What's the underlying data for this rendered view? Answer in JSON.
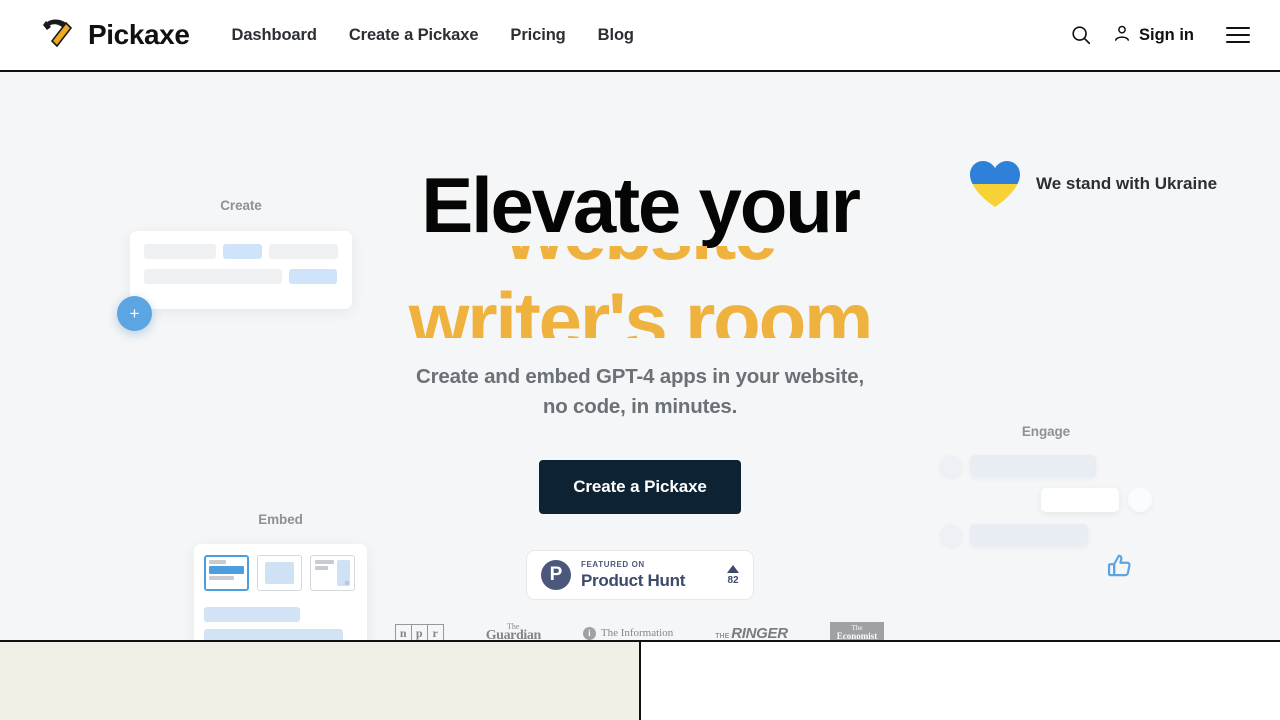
{
  "header": {
    "brand": "Pickaxe",
    "logo_icon": "pickaxe-hammer-icon",
    "nav": [
      {
        "label": "Dashboard"
      },
      {
        "label": "Create a Pickaxe"
      },
      {
        "label": "Pricing"
      },
      {
        "label": "Blog"
      }
    ],
    "search_icon": "search-icon",
    "user_icon": "user-icon",
    "signin_label": "Sign in",
    "menu_icon": "hamburger-menu-icon"
  },
  "ukraine_banner": {
    "icon": "ukraine-flag-heart-icon",
    "text": "We stand with Ukraine",
    "colors": {
      "blue": "#2f80d8",
      "yellow": "#f7d236"
    }
  },
  "hero": {
    "headline_static": "Elevate your",
    "rotating_words": [
      "website",
      "writer's room"
    ],
    "rotating_color": "#f0b23f",
    "subheadline_line1": "Create and embed GPT-4 apps in your website,",
    "subheadline_line2": "no code, in minutes.",
    "cta_label": "Create a Pickaxe",
    "cta_bg": "#0d2233"
  },
  "product_hunt": {
    "badge_letter": "P",
    "featured_on": "FEATURED ON",
    "name": "Product Hunt",
    "upvote_icon": "caret-up-icon",
    "votes": "82",
    "accent": "#4b587c"
  },
  "press_logos": [
    {
      "name": "npr",
      "letters": [
        "n",
        "p",
        "r"
      ]
    },
    {
      "name": "the-guardian",
      "line1": "The",
      "line2": "Guardian"
    },
    {
      "name": "the-information",
      "badge": "i",
      "text": "The Information"
    },
    {
      "name": "the-ringer",
      "prefix": "THE",
      "main": "RINGER"
    },
    {
      "name": "the-economist",
      "line1": "The",
      "line2": "Economist"
    }
  ],
  "mockups": {
    "create": {
      "label": "Create",
      "fab_icon": "plus-icon",
      "fab_color": "#5ba5e2"
    },
    "embed": {
      "label": "Embed",
      "selected_thumbnail": 1
    },
    "engage": {
      "label": "Engage",
      "reaction_icon": "thumbs-up-icon",
      "reaction_color": "#5ba5e2"
    }
  },
  "bottom_section": {
    "left_panel_color": "#f2efe6",
    "right_panel_color": "#ffffff"
  }
}
